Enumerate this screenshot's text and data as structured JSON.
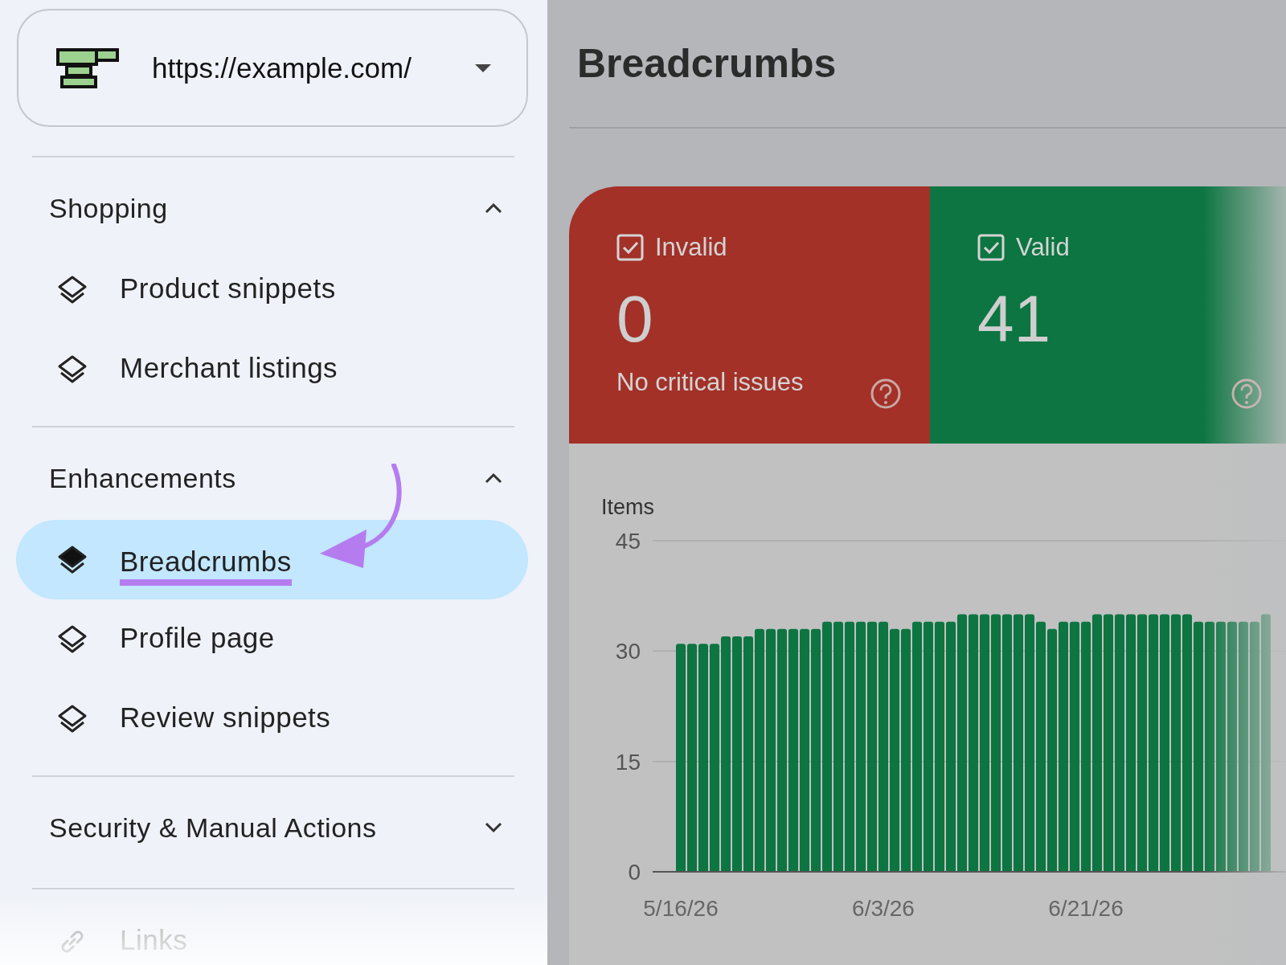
{
  "site_selector": {
    "url": "https://example.com/"
  },
  "sidebar": {
    "sections": [
      {
        "title": "Shopping",
        "expanded": true,
        "items": [
          {
            "label": "Product snippets",
            "kind": "layers",
            "selected": false,
            "annotated": false
          },
          {
            "label": "Merchant listings",
            "kind": "layers",
            "selected": false,
            "annotated": false
          }
        ]
      },
      {
        "title": "Enhancements",
        "expanded": true,
        "items": [
          {
            "label": "Breadcrumbs",
            "kind": "layers",
            "selected": true,
            "annotated": true
          },
          {
            "label": "Profile page",
            "kind": "layers",
            "selected": false,
            "annotated": false
          },
          {
            "label": "Review snippets",
            "kind": "layers",
            "selected": false,
            "annotated": false
          }
        ]
      },
      {
        "title": "Security & Manual Actions",
        "expanded": false
      },
      {
        "items": [
          {
            "label": "Links",
            "kind": "link",
            "selected": false,
            "annotated": false
          }
        ]
      }
    ]
  },
  "main": {
    "title": "Breadcrumbs",
    "status_cards": [
      {
        "kind": "invalid",
        "label": "Invalid",
        "checked": true,
        "count": "0",
        "description": "No critical issues"
      },
      {
        "kind": "valid",
        "label": "Valid",
        "checked": true,
        "count": "41"
      }
    ],
    "chart": {
      "date_labels": [
        "5/16/26",
        "6/3/26",
        "6/21/26"
      ],
      "chart_data": {
        "type": "bar",
        "ylabel": "Items",
        "ylim": [
          0,
          45
        ],
        "yticks": [
          0,
          15,
          30,
          45
        ],
        "series": [
          {
            "color": "#0c7541",
            "values": [
              31,
              31,
              31,
              31,
              32,
              32,
              32,
              33,
              33,
              33,
              33,
              33,
              33,
              34,
              34,
              34,
              34,
              34,
              34,
              33,
              33,
              34,
              34,
              34,
              34,
              35,
              35,
              35,
              35,
              35,
              35,
              35,
              34,
              33,
              34,
              34,
              34,
              35,
              35,
              35,
              35,
              35,
              35,
              35,
              35,
              35,
              34,
              34,
              34,
              34,
              34,
              34,
              35
            ]
          }
        ]
      }
    }
  }
}
